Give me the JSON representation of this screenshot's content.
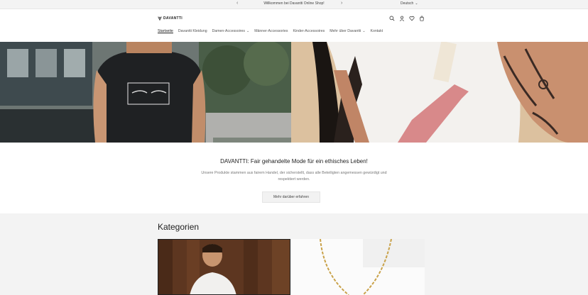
{
  "announcement": {
    "message": "Willkommen bei Davantti Online Shop!",
    "prev_icon": "chevron-left-icon",
    "next_icon": "chevron-right-icon",
    "country": "Deutsch"
  },
  "header": {
    "logo_text": "DAVANTTI",
    "icons": [
      "search-icon",
      "account-icon",
      "wishlist-icon",
      "cart-icon"
    ],
    "nav": [
      {
        "label": "Startseite",
        "active": true,
        "dropdown": false
      },
      {
        "label": "Davantti Kleidung",
        "active": false,
        "dropdown": false
      },
      {
        "label": "Damen-Accessoires",
        "active": false,
        "dropdown": true
      },
      {
        "label": "Männer-Accessories",
        "active": false,
        "dropdown": false
      },
      {
        "label": "Kinder-Accessoires",
        "active": false,
        "dropdown": false
      },
      {
        "label": "Mehr über Davantti",
        "active": false,
        "dropdown": true
      },
      {
        "label": "Kontakt",
        "active": false,
        "dropdown": false
      }
    ]
  },
  "intro": {
    "title": "DAVANTTI: Fair gehandelte Mode für ein ethisches Leben!",
    "description": "Unsere Produkte stammen aus fairem Handel, der sicherstellt, dass alle Beteiligten angemessen gewürdigt und respektiert werden.",
    "cta_label": "Mehr darüber erfahren"
  },
  "categories": {
    "heading": "Kategorien"
  },
  "colors": {
    "announcement_bg": "#f3f3f3",
    "categories_bg": "#f3f3f3",
    "button_bg": "#f2f2f2"
  }
}
